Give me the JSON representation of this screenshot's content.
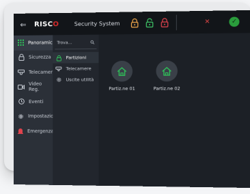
{
  "header": {
    "logo_text": "RISC",
    "logo_accent": "O",
    "title": "Security System",
    "close_symbol": "✕",
    "confirm_symbol": "✓"
  },
  "sidebar": {
    "items": [
      {
        "label": "Panoramica",
        "icon": "grid-icon"
      },
      {
        "label": "Sicurezza",
        "icon": "lock-icon"
      },
      {
        "label": "Telecamere",
        "icon": "camera-icon"
      },
      {
        "label": "Video Reg.",
        "icon": "video-icon"
      },
      {
        "label": "Eventi",
        "icon": "history-icon"
      },
      {
        "label": "Impostazioni",
        "icon": "gear-icon"
      },
      {
        "label": "Emergenza",
        "icon": "alarm-icon"
      }
    ]
  },
  "midlist": {
    "search_placeholder": "Trova...",
    "items": [
      {
        "label": "Partizioni",
        "icon": "lock-icon"
      },
      {
        "label": "Telecamere",
        "icon": "camera-icon"
      },
      {
        "label": "Uscite utilità",
        "icon": "gear-icon"
      }
    ]
  },
  "partitions": [
    {
      "label": "Partiz.ne 01",
      "icon": "home-icon"
    },
    {
      "label": "Partiz.ne 02",
      "icon": "home-icon"
    }
  ],
  "colors": {
    "accent_green": "#2fc55a",
    "lock_orange": "#f0a64a",
    "lock_red": "#e0434d",
    "lock_green": "#3fc567"
  }
}
